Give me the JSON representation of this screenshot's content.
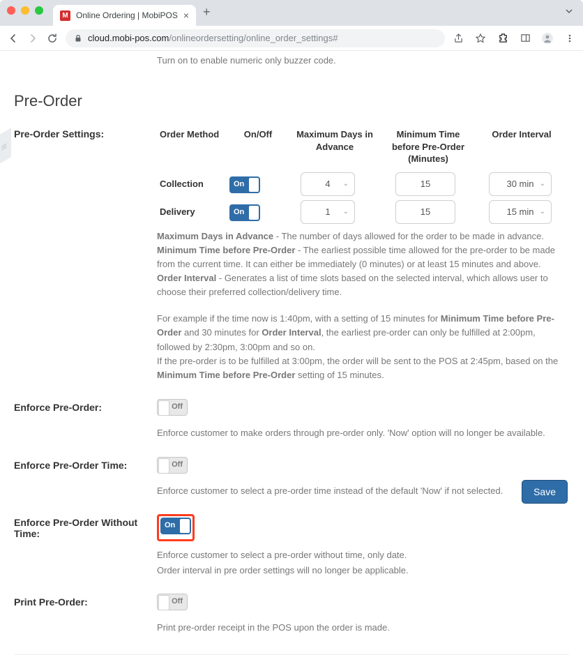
{
  "browser": {
    "tab_title": "Online Ordering | MobiPOS",
    "favicon_letter": "M",
    "url_domain": "cloud.mobi-pos.com",
    "url_path": "/onlineordersetting/online_order_settings#"
  },
  "top_help": "Turn on to enable numeric only buzzer code.",
  "section_title": "Pre-Order",
  "settings_label": "Pre-Order Settings:",
  "headers": {
    "order_method": "Order Method",
    "on_off": "On/Off",
    "max_days": "Maximum Days in Advance",
    "min_time": "Minimum Time before Pre-Order (Minutes)",
    "interval": "Order Interval"
  },
  "rows": {
    "collection": {
      "label": "Collection",
      "toggle": "On",
      "max_days": "4",
      "min_time": "15",
      "interval": "30 min"
    },
    "delivery": {
      "label": "Delivery",
      "toggle": "On",
      "max_days": "1",
      "min_time": "15",
      "interval": "15 min"
    }
  },
  "definitions": {
    "d1_bold": "Maximum Days in Advance",
    "d1_text": " - The number of days allowed for the order to be made in advance.",
    "d2_bold": "Minimum Time before Pre-Order",
    "d2_text": " - The earliest possible time allowed for the pre-order to be made from the current time. It can either be immediately (0 minutes) or at least 15 minutes and above.",
    "d3_bold": "Order Interval",
    "d3_text": " - Generates a list of time slots based on the selected interval, which allows user to choose their preferred collection/delivery time."
  },
  "example": {
    "l1a": "For example if the time now is 1:40pm, with a setting of 15 minutes for ",
    "l1b": "Minimum Time before Pre-Order",
    "l1c": " and 30 minutes for ",
    "l1d": "Order Interval",
    "l1e": ", the earliest pre-order can only be fulfilled at 2:00pm, followed by 2:30pm, 3:00pm and so on.",
    "l2a": "If the pre-order is to be fulfilled at 3:00pm, the order will be sent to the POS at 2:45pm, based on the ",
    "l2b": "Minimum Time before Pre-Order",
    "l2c": " setting of 15 minutes."
  },
  "enforce_preorder": {
    "label": "Enforce Pre-Order:",
    "toggle": "Off",
    "help": "Enforce customer to make orders through pre-order only. 'Now' option will no longer be available."
  },
  "enforce_preorder_time": {
    "label": "Enforce Pre-Order Time:",
    "toggle": "Off",
    "help": "Enforce customer to select a pre-order time instead of the default 'Now' if not selected."
  },
  "enforce_preorder_without_time": {
    "label": "Enforce Pre-Order Without Time:",
    "toggle": "On",
    "help1": "Enforce customer to select a pre-order without time, only date.",
    "help2": "Order interval in pre order settings will no longer be applicable."
  },
  "print_preorder": {
    "label": "Print Pre-Order:",
    "toggle": "Off",
    "help": "Print pre-order receipt in the POS upon the order is made."
  },
  "save_button": "Save"
}
